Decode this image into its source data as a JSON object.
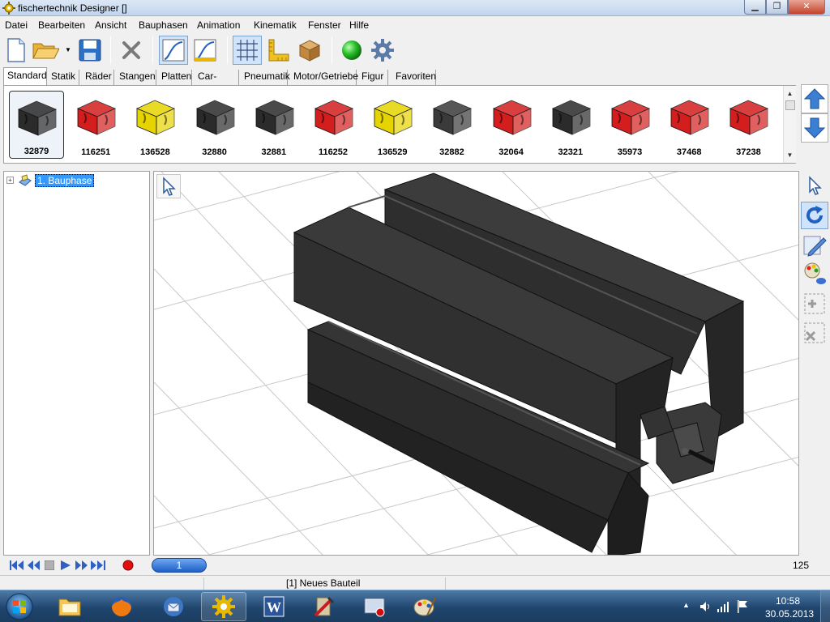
{
  "window": {
    "title": "fischertechnik Designer []",
    "min_label": "▁",
    "max_label": "❐",
    "close_label": "✕"
  },
  "menu": [
    "Datei",
    "Bearbeiten",
    "Ansicht",
    "Bauphasen",
    "Animation",
    "Kinematik",
    "Fenster",
    "Hilfe"
  ],
  "toolbar": {
    "buttons": [
      "new-file-icon",
      "open-folder-icon",
      "save-disk-icon",
      "delete-icon",
      "curve-icon",
      "curve-edit-icon",
      "grid-icon",
      "ruler-icon",
      "box-icon",
      "green-ball-icon",
      "gear-settings-icon"
    ]
  },
  "tabs": [
    "Standard",
    "Statik",
    "Räder",
    "Stangen",
    "Platten",
    "Car-Tech",
    "Pneumatik",
    "Motor/Getriebe",
    "Figur",
    "Favoriten"
  ],
  "parts": [
    {
      "number": "32879",
      "color": "#2b2b2b"
    },
    {
      "number": "116251",
      "color": "#d41e1e"
    },
    {
      "number": "136528",
      "color": "#e6d400"
    },
    {
      "number": "32880",
      "color": "#2b2b2b"
    },
    {
      "number": "32881",
      "color": "#2b2b2b"
    },
    {
      "number": "116252",
      "color": "#d41e1e"
    },
    {
      "number": "136529",
      "color": "#e6d400"
    },
    {
      "number": "32882",
      "color": "#3a3a3a"
    },
    {
      "number": "32064",
      "color": "#d41e1e"
    },
    {
      "number": "32321",
      "color": "#2b2b2b"
    },
    {
      "number": "35973",
      "color": "#d41e1e"
    },
    {
      "number": "37468",
      "color": "#d41e1e"
    },
    {
      "number": "37238",
      "color": "#d41e1e"
    }
  ],
  "tree": {
    "root_label": "1. Bauphase",
    "expander": "+"
  },
  "animation": {
    "phase": "1",
    "zoom": "125"
  },
  "status": {
    "text": "[1] Neues Bauteil"
  },
  "taskbar": {
    "apps": [
      "explorer-icon",
      "firefox-icon",
      "thunderbird-icon",
      "ft-designer-icon",
      "word-icon",
      "tools-icon",
      "recorder-icon",
      "paint-icon"
    ],
    "time": "10:58",
    "date": "30.05.2013"
  },
  "colors": {
    "accent": "#3399ff",
    "part_black": "#2b2b2b"
  }
}
